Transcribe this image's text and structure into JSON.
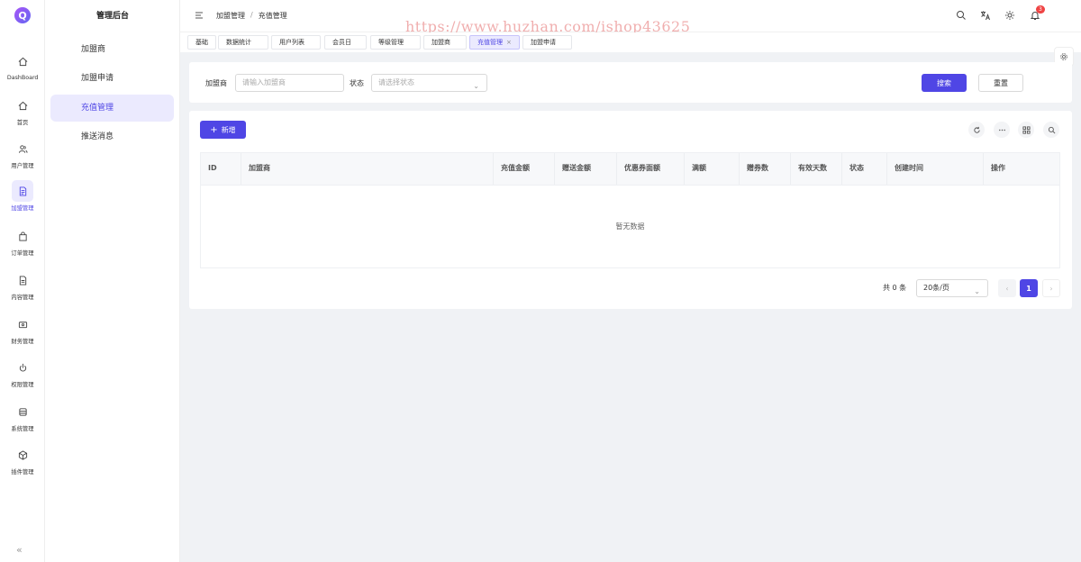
{
  "app": {
    "logo_letter": "Q",
    "title": "管理后台"
  },
  "rail": {
    "items": [
      {
        "label": "DashBoard",
        "icon": "home-icon"
      },
      {
        "label": "首页",
        "icon": "home-icon"
      },
      {
        "label": "用户管理",
        "icon": "users-icon"
      },
      {
        "label": "加盟管理",
        "icon": "document-icon"
      },
      {
        "label": "订单管理",
        "icon": "bag-icon"
      },
      {
        "label": "内容管理",
        "icon": "file-icon"
      },
      {
        "label": "财务管理",
        "icon": "wallet-icon"
      },
      {
        "label": "权限管理",
        "icon": "power-icon"
      },
      {
        "label": "系统管理",
        "icon": "database-icon"
      },
      {
        "label": "插件管理",
        "icon": "cube-icon"
      }
    ],
    "collapse_label": "«"
  },
  "submenu": {
    "items": [
      {
        "label": "加盟商"
      },
      {
        "label": "加盟申请"
      },
      {
        "label": "充值管理"
      },
      {
        "label": "推送消息"
      }
    ]
  },
  "header": {
    "breadcrumb": [
      "加盟管理",
      "充值管理"
    ],
    "breadcrumb_sep": "/",
    "notification_count": "3",
    "watermark": "https://www.huzhan.com/ishop43625"
  },
  "tabs": [
    {
      "label": "基础"
    },
    {
      "label": "数据统计"
    },
    {
      "label": "用户列表"
    },
    {
      "label": "会员日"
    },
    {
      "label": "等级管理"
    },
    {
      "label": "加盟商"
    },
    {
      "label": "充值管理",
      "close": "×"
    },
    {
      "label": "加盟申请"
    }
  ],
  "search": {
    "franchisee_label": "加盟商",
    "franchisee_placeholder": "请输入加盟商",
    "status_label": "状态",
    "status_placeholder": "请选择状态",
    "search_button": "搜索",
    "reset_button": "重置"
  },
  "table": {
    "add_button": "新增",
    "add_icon": "+",
    "columns": [
      "ID",
      "加盟商",
      "充值金额",
      "赠送金额",
      "优惠券面额",
      "满额",
      "赠券数",
      "有效天数",
      "状态",
      "创建时间",
      "操作"
    ],
    "empty_text": "暂无数据"
  },
  "pager": {
    "total": "共 0 条",
    "page_size": "20条/页",
    "prev": "‹",
    "current": "1",
    "next": "›"
  },
  "colors": {
    "accent": "#4f46e5",
    "accent_light": "#ebeafe",
    "badge": "#ef4444"
  }
}
